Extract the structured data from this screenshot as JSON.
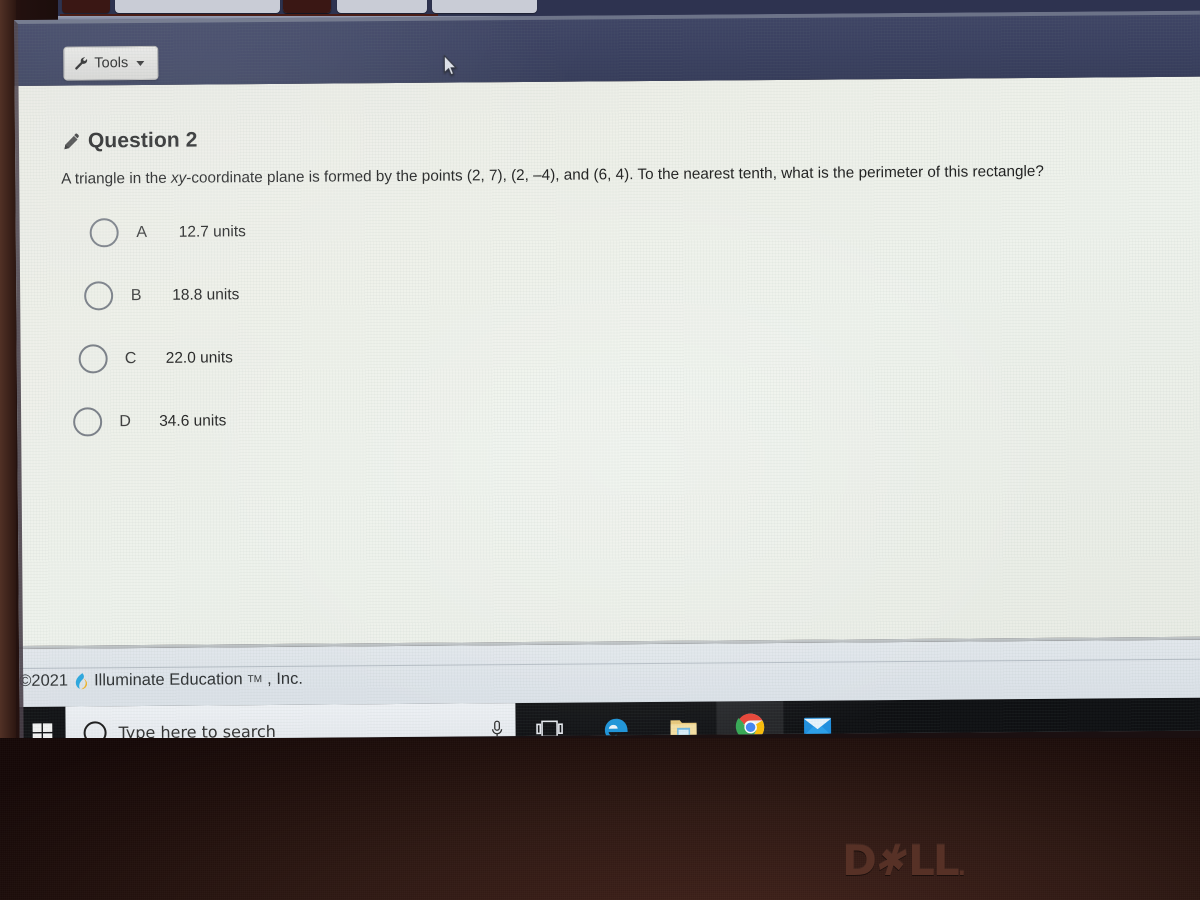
{
  "app": {
    "header": {
      "tools_label": "Tools",
      "tools_icon": "wrench-icon",
      "caret_icon": "chevron-down-icon",
      "bar_color": "#3a4060"
    }
  },
  "question": {
    "icon": "pencil-icon",
    "title": "Question 2",
    "prompt_part1": "A triangle in the ",
    "prompt_italic": "xy",
    "prompt_part2": "-coordinate plane is formed by the points (2, 7), (2, –4), and (6, 4). To the nearest tenth, what is the perimeter of this rectangle?",
    "prompt_full": "A triangle in the xy-coordinate plane is formed by the points (2, 7), (2, –4), and (6, 4). To the nearest tenth, what is the perimeter of this rectangle?",
    "choices": [
      {
        "letter": "A",
        "text": "12.7 units",
        "selected": false
      },
      {
        "letter": "B",
        "text": "18.8 units",
        "selected": false
      },
      {
        "letter": "C",
        "text": "22.0 units",
        "selected": false
      },
      {
        "letter": "D",
        "text": "34.6 units",
        "selected": false
      }
    ]
  },
  "footer": {
    "copyright_prefix": "©2021",
    "logo_icon": "illuminate-flame-logo",
    "company": "Illuminate Education",
    "trademark": "TM",
    "suffix": ", Inc."
  },
  "taskbar": {
    "start_icon": "windows-start-icon",
    "search": {
      "cortana_icon": "cortana-circle-icon",
      "placeholder": "Type here to search",
      "value": "",
      "mic_icon": "microphone-icon"
    },
    "items": [
      {
        "name": "task-view",
        "icon": "task-view-icon",
        "active": false
      },
      {
        "name": "microsoft-edge",
        "icon": "edge-icon",
        "active": false
      },
      {
        "name": "file-explorer",
        "icon": "folder-icon",
        "active": false
      },
      {
        "name": "google-chrome",
        "icon": "chrome-icon",
        "active": true
      },
      {
        "name": "mail",
        "icon": "mail-envelope-icon",
        "active": false
      }
    ]
  },
  "hardware": {
    "brand": "DELL",
    "cursor_icon": "mouse-pointer-icon"
  },
  "colors": {
    "header_navy": "#3a4060",
    "content_bg": "#eef0e9",
    "taskbar_black": "#0e0f12",
    "chrome_blue": "#37a6e8",
    "dell_bezel": "#301a14"
  }
}
